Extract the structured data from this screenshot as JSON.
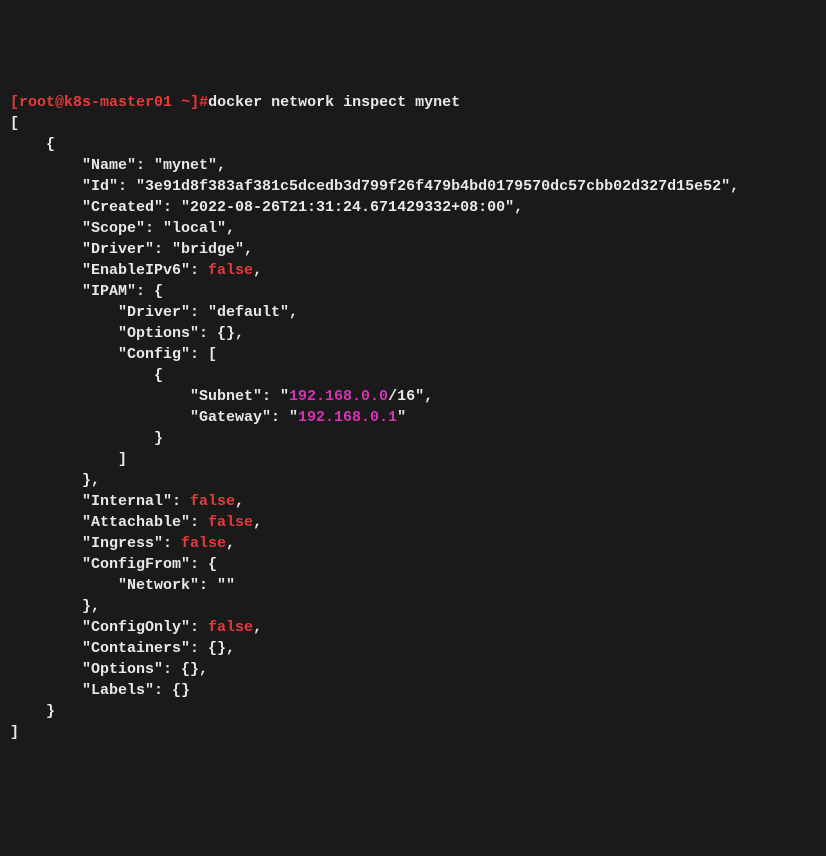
{
  "prompt": {
    "open_bracket": "[",
    "userhost": "root@k8s-master01",
    "space": " ",
    "tilde": "~",
    "close": "]#",
    "command": "docker network inspect mynet"
  },
  "lines": {
    "l1": "[",
    "l2": "    {",
    "l3": "        \"Name\": \"mynet\",",
    "l4": "        \"Id\": \"3e91d8f383af381c5dcedb3d799f26f479b4bd0179570dc57cbb02d327d15e52\",",
    "l5": "        \"Created\": \"2022-08-26T21:31:24.671429332+08:00\",",
    "l6": "        \"Scope\": \"local\",",
    "l7": "        \"Driver\": \"bridge\",",
    "l8a": "        \"EnableIPv6\": ",
    "l8b": "false",
    "l8c": ",",
    "l9": "        \"IPAM\": {",
    "l10": "            \"Driver\": \"default\",",
    "l11": "            \"Options\": {},",
    "l12": "            \"Config\": [",
    "l13": "                {",
    "l14a": "                    \"Subnet\": \"",
    "l14b": "192.168.0.0",
    "l14c": "/16\",",
    "l15a": "                    \"Gateway\": \"",
    "l15b": "192.168.0.1",
    "l15c": "\"",
    "l16": "                }",
    "l17": "            ]",
    "l18": "        },",
    "l19a": "        \"Internal\": ",
    "l19b": "false",
    "l19c": ",",
    "l20a": "        \"Attachable\": ",
    "l20b": "false",
    "l20c": ",",
    "l21a": "        \"Ingress\": ",
    "l21b": "false",
    "l21c": ",",
    "l22": "        \"ConfigFrom\": {",
    "l23": "            \"Network\": \"\"",
    "l24": "        },",
    "l25a": "        \"ConfigOnly\": ",
    "l25b": "false",
    "l25c": ",",
    "l26": "        \"Containers\": {},",
    "l27": "        \"Options\": {},",
    "l28": "        \"Labels\": {}",
    "l29": "    }",
    "l30": "]"
  }
}
